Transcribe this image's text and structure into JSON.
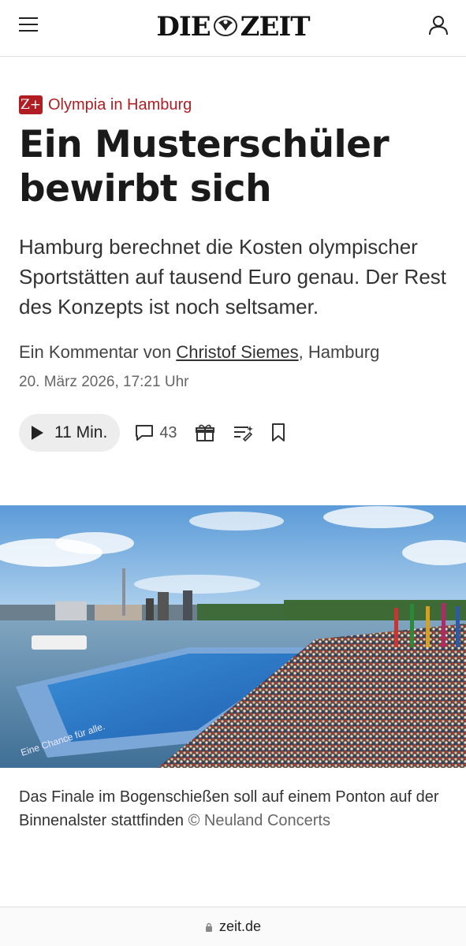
{
  "header": {
    "logo_left": "DIE",
    "logo_right": "ZEIT",
    "menu_icon": "hamburger-menu-icon",
    "user_icon": "user-account-icon"
  },
  "article": {
    "zplus_badge": "Z+",
    "kicker": "Olympia in Hamburg",
    "headline": "Ein Musterschüler bewirbt sich",
    "summary": "Hamburg berechnet die Kosten olympischer Sportstätten auf tausend Euro genau. Der Rest des Konzepts ist noch seltsamer.",
    "byline_prefix": "Ein Kommentar von",
    "author": "Christof Siemes",
    "byline_suffix": ", Hamburg",
    "date": "20. März 2026, 17:21 Uhr"
  },
  "toolbar": {
    "listen_label": "11 Min.",
    "comments_count": "43",
    "icons": [
      "play-icon",
      "comment-icon",
      "gift-icon",
      "summary-icon",
      "bookmark-icon"
    ]
  },
  "image": {
    "caption": "Das Finale im Bogenschießen soll auf einem Ponton auf der Binnenalster stattfinden",
    "credit": "© Neuland Concerts",
    "banner_text": "Eine Chance für alle."
  },
  "browser": {
    "url": "zeit.de"
  },
  "colors": {
    "accent": "#b01e23",
    "text": "#1a1a1a",
    "muted": "#666666"
  }
}
